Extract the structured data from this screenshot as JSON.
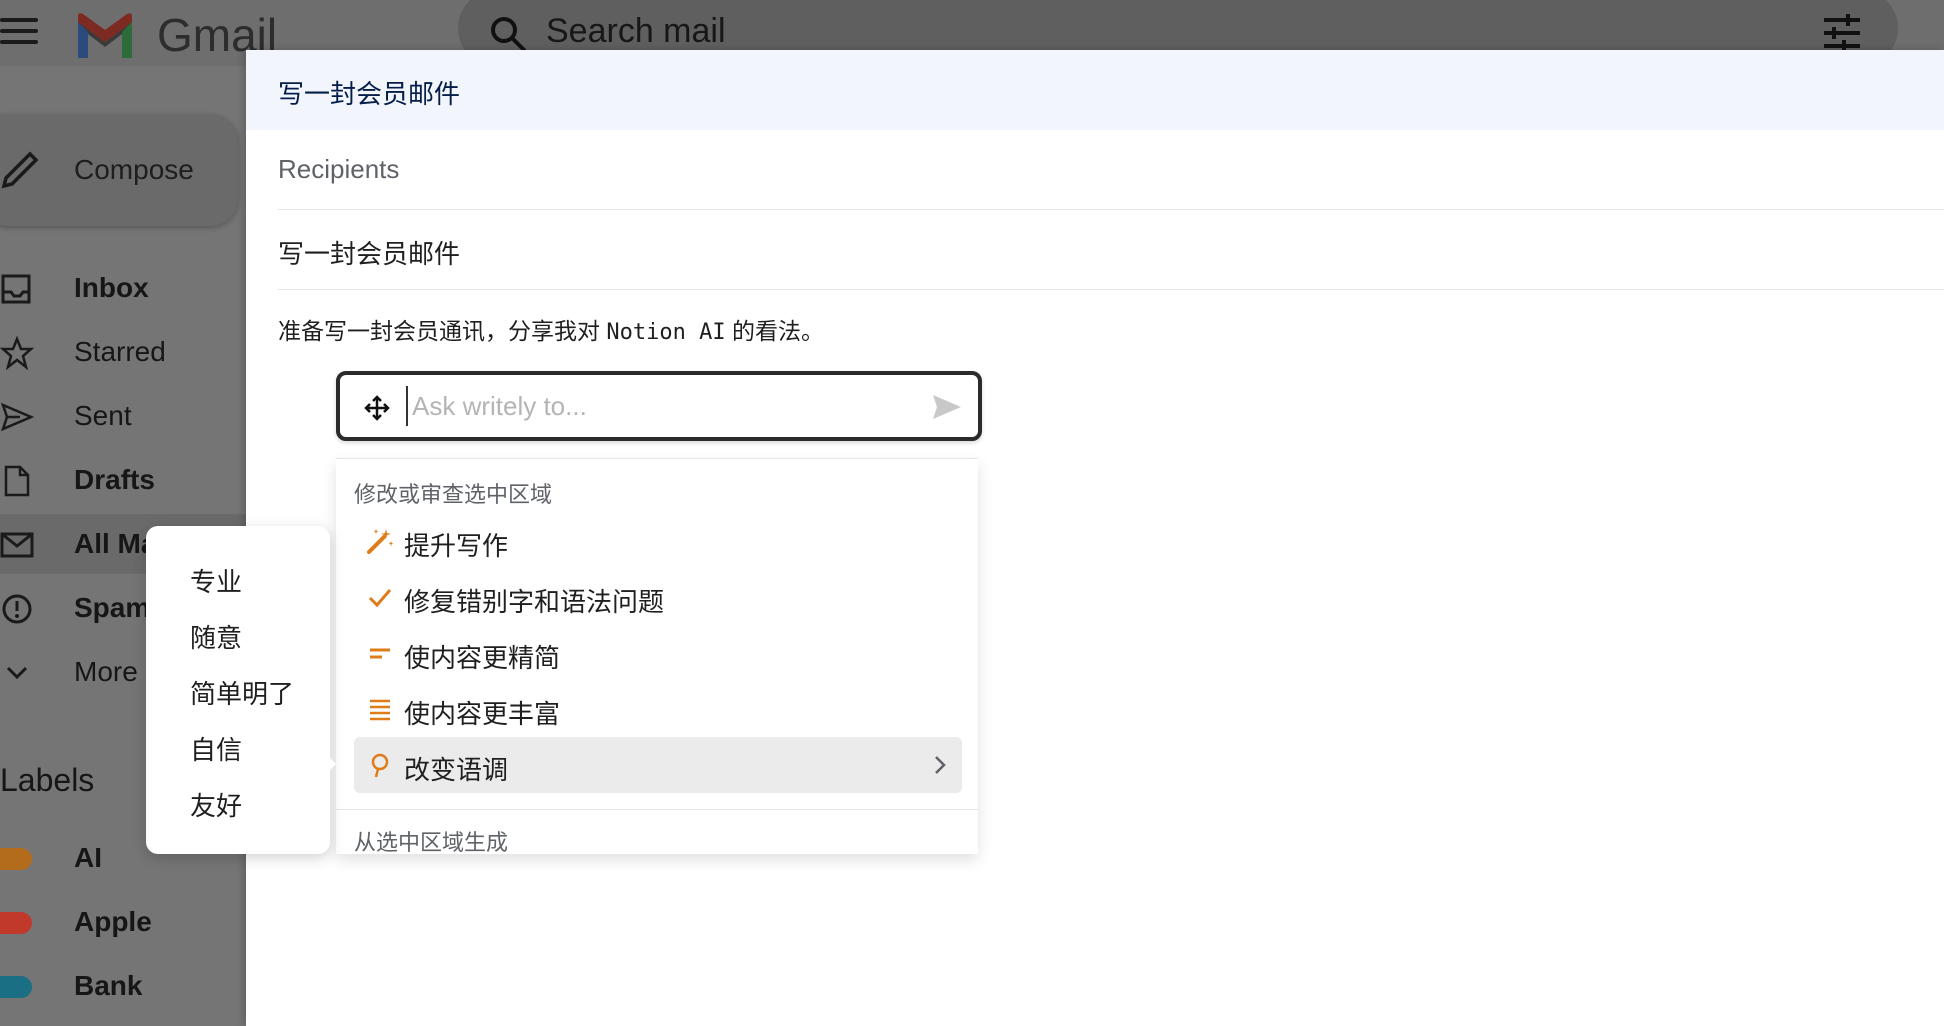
{
  "app": {
    "brand": "Gmail",
    "search_placeholder": "Search mail"
  },
  "sidebar": {
    "compose_label": "Compose",
    "items": [
      {
        "label": "Inbox",
        "icon": "inbox-icon"
      },
      {
        "label": "Starred",
        "icon": "star-icon"
      },
      {
        "label": "Sent",
        "icon": "send-icon"
      },
      {
        "label": "Drafts",
        "icon": "draft-icon"
      },
      {
        "label": "All Ma",
        "icon": "mail-icon"
      },
      {
        "label": "Spam",
        "icon": "spam-icon"
      },
      {
        "label": "More",
        "icon": "chevron-down-icon"
      }
    ],
    "labels_heading": "Labels",
    "labels": [
      {
        "label": "AI",
        "color": "#b36b1c"
      },
      {
        "label": "Apple",
        "color": "#c0392b"
      },
      {
        "label": "Bank",
        "color": "#1a6f85"
      }
    ]
  },
  "compose": {
    "title": "写一封会员邮件",
    "recipients_placeholder": "Recipients",
    "subject": "写一封会员邮件",
    "body_prefix": "准备写一封会员通讯，分享我对 ",
    "body_code": "Notion AI",
    "body_suffix": " 的看法。"
  },
  "ai_panel": {
    "input_placeholder": "Ask writely to...",
    "section_edit": "修改或审查选中区域",
    "items": [
      {
        "label": "提升写作",
        "icon": "magic-wand-icon"
      },
      {
        "label": "修复错别字和语法问题",
        "icon": "check-icon"
      },
      {
        "label": "使内容更精简",
        "icon": "short-lines-icon"
      },
      {
        "label": "使内容更丰富",
        "icon": "long-lines-icon"
      },
      {
        "label": "改变语调",
        "icon": "tone-icon"
      }
    ],
    "section_generate": "从选中区域生成",
    "accent_color": "#e07b1a"
  },
  "tone_menu": {
    "options": [
      "专业",
      "随意",
      "简单明了",
      "自信",
      "友好"
    ]
  }
}
